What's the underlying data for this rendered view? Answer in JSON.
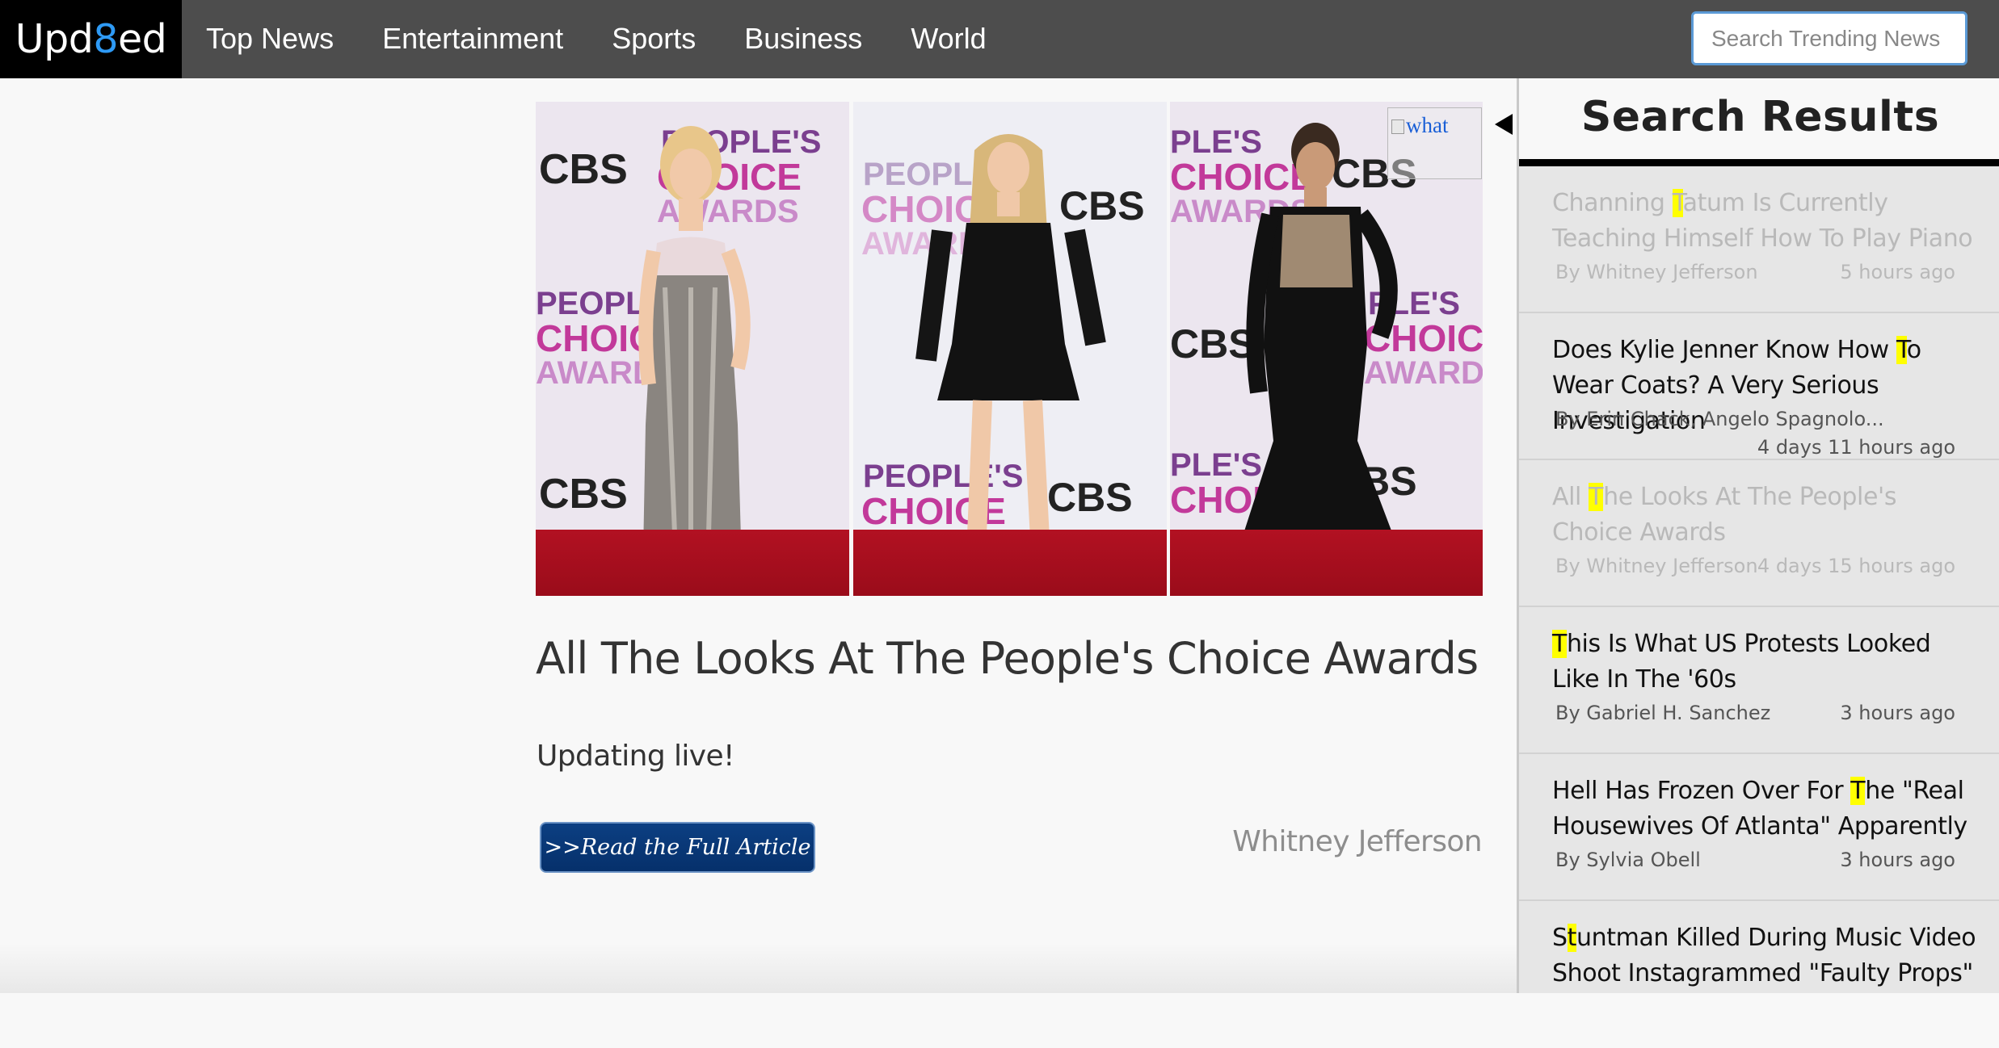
{
  "logo": {
    "part1": "Upd",
    "accent": "8",
    "part2": "ed"
  },
  "nav": {
    "items": [
      "Top News",
      "Entertainment",
      "Sports",
      "Business",
      "World"
    ]
  },
  "search": {
    "placeholder": "Search Trending News",
    "value": ""
  },
  "hero": {
    "broken_image_alt": "what",
    "photos": [
      {
        "backdrop_text": [
          "CBS",
          "PEOPLE'S",
          "CHOICE",
          "AWARDS"
        ]
      },
      {
        "backdrop_text": [
          "PEOPLE'S",
          "CHOICE",
          "AWARDS",
          "CBS"
        ]
      },
      {
        "backdrop_text": [
          "PLE'S",
          "CBS",
          "CHOICE",
          "AWARDS"
        ]
      }
    ]
  },
  "article": {
    "title": "All The Looks At The People's Choice Awards",
    "subtitle": "Updating live!",
    "read_button": ">>Read the Full Article",
    "author": "Whitney Jefferson"
  },
  "panel": {
    "title": "Search Results",
    "results": [
      {
        "pre": "Channing ",
        "hl": "T",
        "post": "atum Is Currently Teaching Himself How To Play Piano",
        "author": "By Whitney Jefferson",
        "time": "5 hours ago",
        "faded": true
      },
      {
        "pre": "Does Kylie Jenner Know How ",
        "hl": "T",
        "post": "o Wear Coats? A Very Serious Investigation",
        "author": "By Erin Chack, Angelo Spagnolo...",
        "time": "4 days 11 hours ago",
        "faded": false
      },
      {
        "pre": "All ",
        "hl": "T",
        "post": "he Looks At The People's Choice Awards",
        "author": "By Whitney Jefferson",
        "time": "4 days 15 hours ago",
        "faded": true
      },
      {
        "pre": "",
        "hl": "T",
        "post": "his Is What US Protests Looked Like In The '60s",
        "author": "By Gabriel H. Sanchez",
        "time": "3 hours ago",
        "faded": false
      },
      {
        "pre": "Hell Has Frozen Over For ",
        "hl": "T",
        "post": "he \"Real Housewives Of Atlanta\" Apparently",
        "author": "By Sylvia Obell",
        "time": "3 hours ago",
        "faded": false
      },
      {
        "pre": "S",
        "hl": "t",
        "post": "untman Killed During Music Video Shoot Instagrammed \"Faulty Props\"",
        "author": "",
        "time": "",
        "faded": false
      }
    ]
  },
  "colors": {
    "nav_bg": "#4d4d4d",
    "logo_bg": "#000000",
    "logo_accent": "#2e9af5",
    "highlight": "#ffff00",
    "button_bg": "#0c3f82",
    "carpet": "#b21122"
  }
}
